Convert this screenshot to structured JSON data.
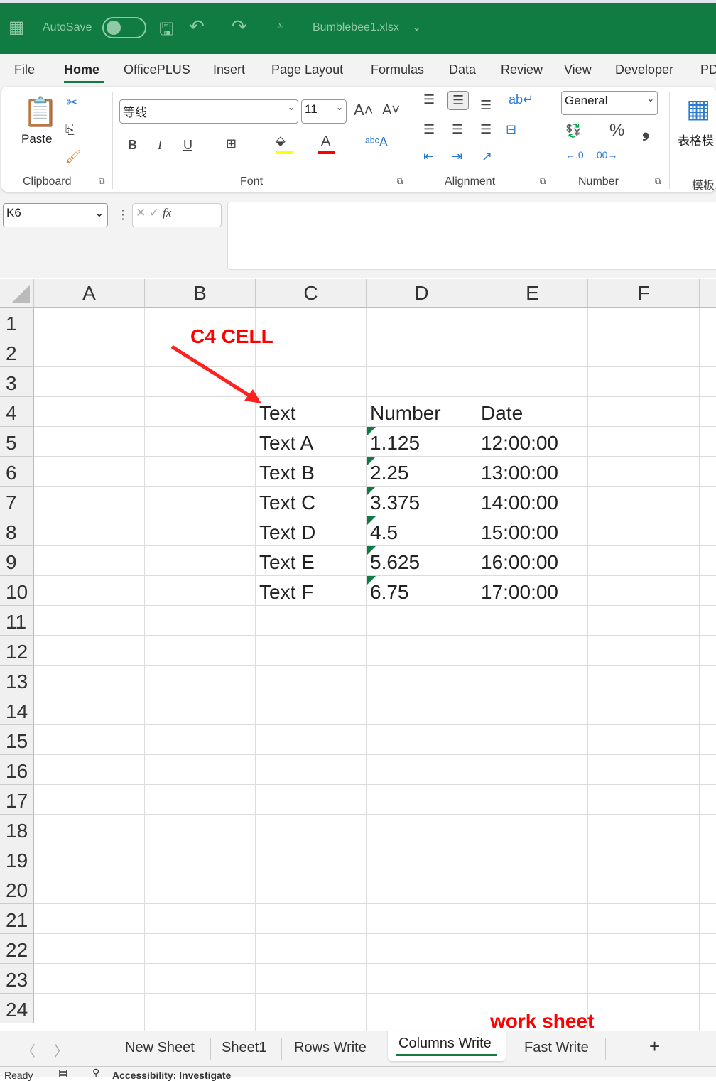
{
  "titlebar": {
    "autosave_label": "AutoSave",
    "filename": "Bumblebee1.xlsx",
    "autosave_on": false
  },
  "menu": [
    "File",
    "Home",
    "OfficePLUS",
    "Insert",
    "Page Layout",
    "Formulas",
    "Data",
    "Review",
    "View",
    "Developer",
    "PD"
  ],
  "active_menu": "Home",
  "ribbon": {
    "clipboard": {
      "paste": "Paste",
      "label": "Clipboard"
    },
    "font": {
      "name": "等线",
      "size": "11",
      "label": "Font",
      "bold": "B",
      "italic": "I",
      "underline": "U",
      "highlight_color": "#ffff00",
      "font_color": "#ff0000"
    },
    "alignment": {
      "label": "Alignment"
    },
    "number": {
      "format": "General",
      "label": "Number",
      "percent": "%",
      "comma": "❟"
    },
    "extra": {
      "label_top": "表格模",
      "label_bottom": "模板"
    }
  },
  "formula_bar": {
    "name_box": "K6",
    "fx": "fx",
    "value": ""
  },
  "columns": [
    "A",
    "B",
    "C",
    "D",
    "E",
    "F"
  ],
  "rows": [
    "1",
    "2",
    "3",
    "4",
    "5",
    "6",
    "7",
    "8",
    "9",
    "10",
    "11",
    "12",
    "13",
    "14",
    "15",
    "16",
    "17",
    "18",
    "19",
    "20",
    "21",
    "22",
    "23",
    "24"
  ],
  "table": {
    "headers": [
      "Text",
      "Number",
      "Date"
    ],
    "rows": [
      [
        "Text A",
        "1.125",
        "12:00:00"
      ],
      [
        "Text B",
        "2.25",
        "13:00:00"
      ],
      [
        "Text C",
        "3.375",
        "14:00:00"
      ],
      [
        "Text D",
        "4.5",
        "15:00:00"
      ],
      [
        "Text E",
        "5.625",
        "16:00:00"
      ],
      [
        "Text F",
        "6.75",
        "17:00:00"
      ]
    ]
  },
  "annotations": {
    "c4": "C4 CELL",
    "worksheet": "work sheet",
    "color": "#ff0000"
  },
  "sheets": [
    "New Sheet",
    "Sheet1",
    "Rows Write",
    "Columns Write",
    "Fast Write"
  ],
  "active_sheet": "Columns Write",
  "add_sheet": "+",
  "status": {
    "ready": "Ready",
    "accessibility": "Accessibility: Investigate"
  }
}
